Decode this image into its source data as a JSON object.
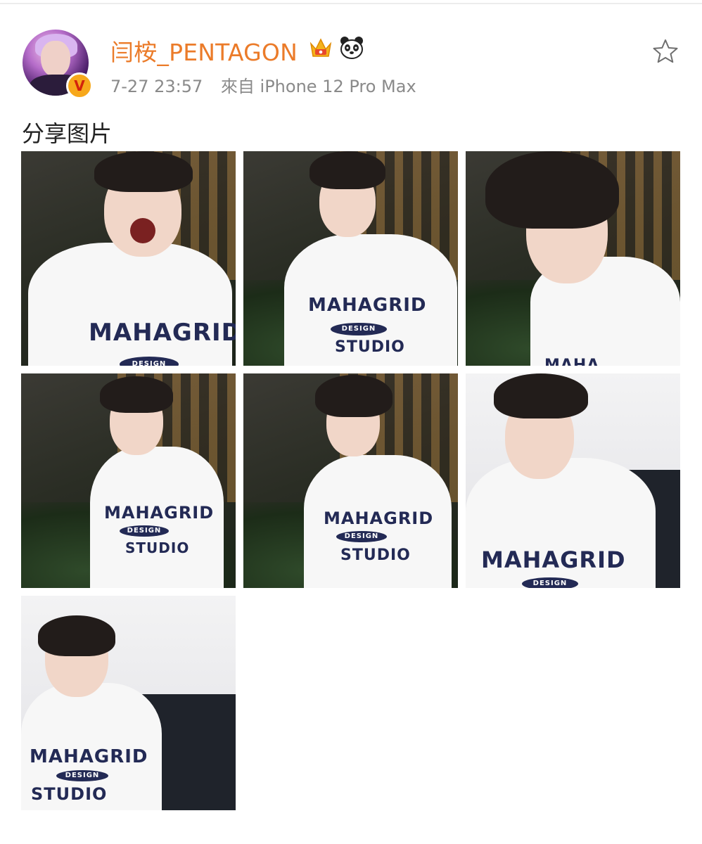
{
  "post": {
    "username": "闫桉_PENTAGON",
    "badge_label": "V",
    "timestamp": "7-27 23:57",
    "source": "來自 iPhone 12 Pro Max",
    "text": "分享图片"
  },
  "icons": {
    "crown": "crown-icon",
    "panda": "panda-icon",
    "star": "star-icon",
    "verified": "verified-badge"
  },
  "photos": [
    {
      "print_line1": "MAHAGRID",
      "print_line2": "DESIGN"
    },
    {
      "print_line1": "MAHAGRID",
      "print_line2": "DESIGN",
      "print_line3": "STUDIO"
    },
    {
      "print_line1": "MAHA"
    },
    {
      "print_line1": "MAHAGRID",
      "print_line2": "DESIGN",
      "print_line3": "STUDIO"
    },
    {
      "print_line1": "MAHAGRID",
      "print_line2": "DESIGN",
      "print_line3": "STUDIO"
    },
    {
      "print_line1": "MAHAGRID",
      "print_line2": "DESIGN"
    },
    {
      "print_line1": "MAHAGRID",
      "print_line2": "DESIGN",
      "print_line3": "STUDIO"
    }
  ],
  "colors": {
    "username": "#eb7b29",
    "meta": "#8a8a8a",
    "text": "#222222",
    "vip_badge": "#f7a81b"
  }
}
